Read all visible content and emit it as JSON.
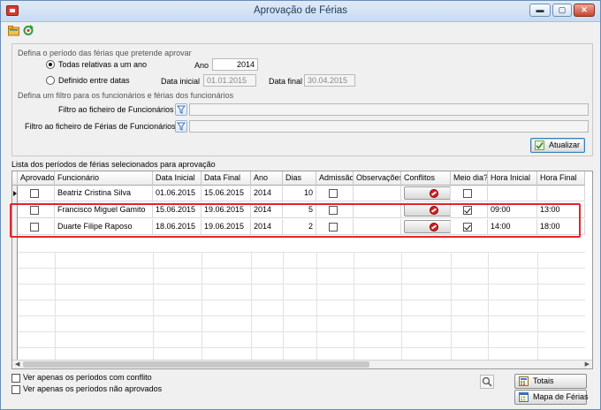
{
  "window": {
    "title": "Aprovação de Férias",
    "controls": {
      "minimize": "▬",
      "maximize": "▢",
      "close": "✕"
    }
  },
  "toolbar": {
    "icons": [
      "folder-icon",
      "refresh-icon"
    ]
  },
  "period": {
    "title": "Defina o período das férias que pretende aprovar",
    "radio_all_label": "Todas relativas a um ano",
    "radio_range_label": "Definido entre datas",
    "year_label": "Ano",
    "year_value": "2014",
    "start_label": "Data inicial",
    "start_value": "01.01.2015",
    "end_label": "Data final",
    "end_value": "30.04.2015",
    "selected": "all"
  },
  "filter": {
    "title": "Defina um filtro para os funcionários e férias dos funcionários",
    "employees_label": "Filtro ao ficheiro de Funcionários",
    "vacations_label": "Filtro ao ficheiro de Férias de Funcionários",
    "employees_value": "",
    "vacations_value": ""
  },
  "update_button": "Atualizar",
  "list": {
    "title": "Lista dos períodos de férias selecionados para aprovação",
    "columns": [
      "Aprovado?",
      "Funcionário",
      "Data Inicial",
      "Data Final",
      "Ano",
      "Dias",
      "Admissão?",
      "Observações",
      "Conflitos",
      "Meio dia?",
      "Hora Inicial",
      "Hora Final"
    ],
    "rows": [
      {
        "approved": false,
        "employee": "Beatriz Cristina Silva",
        "start": "01.06.2015",
        "end": "15.06.2015",
        "year": "2014",
        "days": "10",
        "admission": false,
        "notes": "",
        "half_day": false,
        "start_time": "",
        "end_time": ""
      },
      {
        "approved": false,
        "employee": "Francisco Miguel Gamito",
        "start": "15.06.2015",
        "end": "19.06.2015",
        "year": "2014",
        "days": "5",
        "admission": false,
        "notes": "",
        "half_day": true,
        "start_time": "09:00",
        "end_time": "13:00"
      },
      {
        "approved": false,
        "employee": "Duarte Filipe Raposo",
        "start": "18.06.2015",
        "end": "19.06.2015",
        "year": "2014",
        "days": "2",
        "admission": false,
        "notes": "",
        "half_day": true,
        "start_time": "14:00",
        "end_time": "18:00"
      }
    ]
  },
  "bottom": {
    "show_conflicts_label": "Ver apenas os períodos com conflito",
    "show_unapproved_label": "Ver apenas os períodos não aprovados",
    "totals_button": "Totais",
    "vacation_map_button": "Mapa de Férias"
  },
  "colors": {
    "highlight": "#e0262b",
    "title_text": "#1e395b",
    "conflict_icon": "#d42020"
  }
}
